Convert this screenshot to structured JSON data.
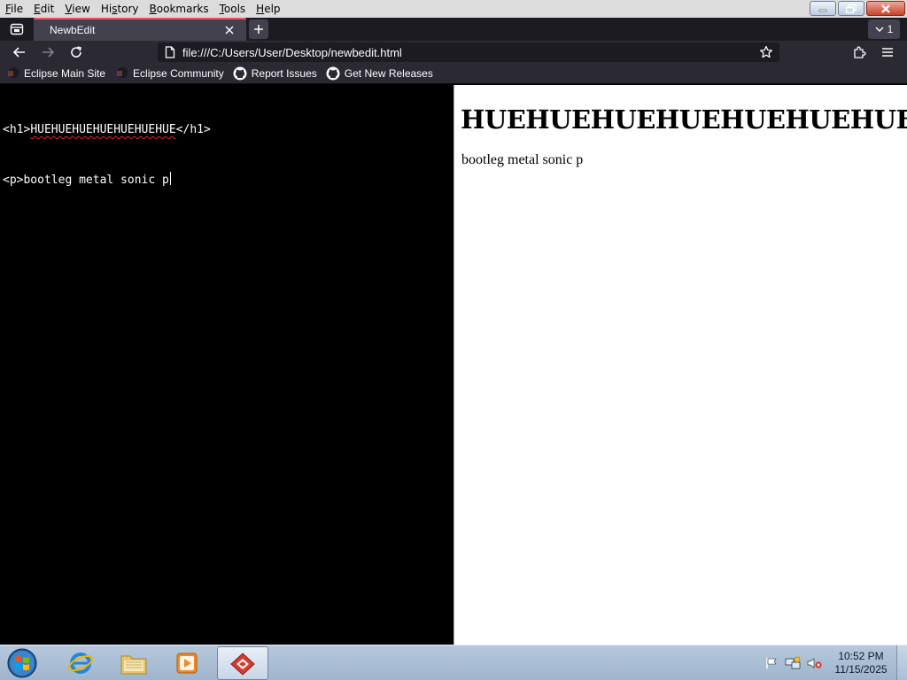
{
  "menu": {
    "items": [
      {
        "label": "File",
        "accel": "F",
        "rest": "ile"
      },
      {
        "label": "Edit",
        "accel": "E",
        "rest": "dit"
      },
      {
        "label": "View",
        "accel": "V",
        "rest": "iew"
      },
      {
        "label": "History",
        "accel": "s",
        "rest": "tory",
        "pre": "Hi"
      },
      {
        "label": "Bookmarks",
        "accel": "B",
        "rest": "ookmarks"
      },
      {
        "label": "Tools",
        "accel": "T",
        "rest": "ools"
      },
      {
        "label": "Help",
        "accel": "H",
        "rest": "elp"
      }
    ]
  },
  "tabs": {
    "active_title": "NewbEdit",
    "count": "1"
  },
  "navbar": {
    "url": "file:///C:/Users/User/Desktop/newbedit.html"
  },
  "bookmarks": [
    {
      "label": "Eclipse Main Site",
      "icon": "eclipse-icon"
    },
    {
      "label": "Eclipse Community",
      "icon": "eclipse-icon"
    },
    {
      "label": "Report Issues",
      "icon": "github-icon"
    },
    {
      "label": "Get New Releases",
      "icon": "github-icon"
    }
  ],
  "editor": {
    "line1_open": "<h1>",
    "line1_text": "HUEHUEHUEHUEHUEHUEHUE",
    "line1_close": "</h1>",
    "line2": "<p>bootleg metal sonic p"
  },
  "preview": {
    "heading": "HUEHUEHUEHUEHUEHUEHUE",
    "paragraph": "bootleg metal sonic p"
  },
  "taskbar": {
    "time": "10:52 PM",
    "date": "11/15/2025"
  },
  "colors": {
    "tab_accent": "#ff4f5e",
    "browser_dark": "#2b2a33",
    "editor_bg": "#000000",
    "preview_bg": "#ffffff"
  }
}
